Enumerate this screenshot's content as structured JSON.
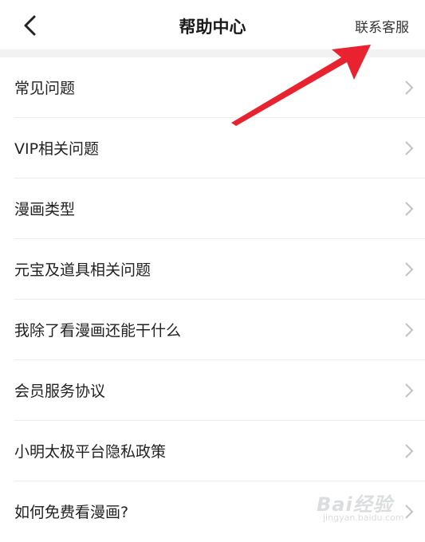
{
  "header": {
    "title": "帮助中心",
    "contact_label": "联系客服",
    "back_icon": "chevron-left-icon"
  },
  "list": {
    "items": [
      {
        "label": "常见问题"
      },
      {
        "label": "VIP相关问题"
      },
      {
        "label": "漫画类型"
      },
      {
        "label": "元宝及道具相关问题"
      },
      {
        "label": "我除了看漫画还能干什么"
      },
      {
        "label": "会员服务协议"
      },
      {
        "label": "小明太极平台隐私政策"
      },
      {
        "label": "如何免费看漫画?"
      }
    ],
    "chevron_icon": "chevron-right-icon"
  },
  "annotation": {
    "color": "#e8232f"
  },
  "watermark": {
    "logo": "Bai经验",
    "sub": "jingyan.baidu.com"
  }
}
